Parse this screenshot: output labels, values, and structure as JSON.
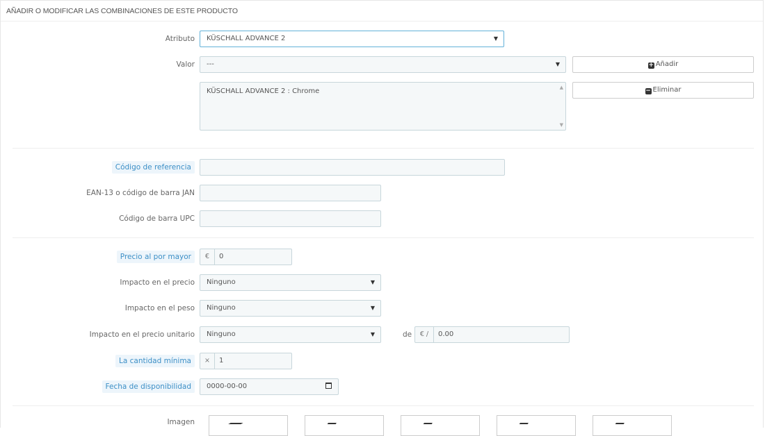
{
  "panel": {
    "heading": "AÑADIR O MODIFICAR LAS COMBINACIONES DE ESTE PRODUCTO"
  },
  "attribute": {
    "label": "Atributo",
    "value": "KÜSCHALL ADVANCE 2"
  },
  "valor": {
    "label": "Valor",
    "value": "---",
    "add_button": "Añadir"
  },
  "combination_list": {
    "items": [
      "KÜSCHALL ADVANCE 2 : Chrome"
    ],
    "delete_button": "Eliminar"
  },
  "reference": {
    "label": "Código de referencia",
    "value": ""
  },
  "ean13": {
    "label": "EAN-13 o código de barra JAN",
    "value": ""
  },
  "upc": {
    "label": "Código de barra UPC",
    "value": ""
  },
  "wholesale": {
    "label": "Precio al por mayor",
    "currency": "€",
    "value": "0"
  },
  "price_impact": {
    "label": "Impacto en el precio",
    "value": "Ninguno"
  },
  "weight_impact": {
    "label": "Impacto en el peso",
    "value": "Ninguno"
  },
  "unit_price_impact": {
    "label": "Impacto en el precio unitario",
    "value": "Ninguno",
    "de_label": "de",
    "unit_addon": "€ /",
    "unit_value": "0.00"
  },
  "min_quantity": {
    "label": "La cantidad mínima",
    "addon": "×",
    "value": "1"
  },
  "availability": {
    "label": "Fecha de disponibilidad",
    "value": "0000-00-00"
  },
  "images": {
    "label": "Imagen",
    "count": 5
  },
  "colors": {
    "input_bg": "#f5f8f9",
    "input_border": "#c7d6db",
    "focus_border": "#62b1d9",
    "required_label": "#3c8fc6"
  }
}
